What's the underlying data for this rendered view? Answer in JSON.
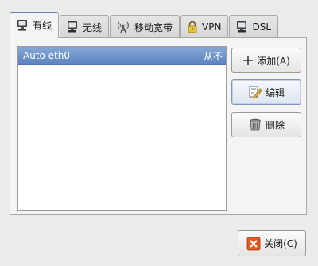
{
  "tabs": [
    {
      "label": "有线",
      "icon": "wired-network-icon",
      "active": true
    },
    {
      "label": "无线",
      "icon": "wireless-network-icon",
      "active": false
    },
    {
      "label": "移动宽带",
      "icon": "mobile-broadband-icon",
      "active": false
    },
    {
      "label": "VPN",
      "icon": "vpn-lock-icon",
      "active": false
    },
    {
      "label": "DSL",
      "icon": "dsl-network-icon",
      "active": false
    }
  ],
  "connections": [
    {
      "name": "Auto eth0",
      "last_used": "从不",
      "selected": true
    }
  ],
  "buttons": {
    "add_label": "添加(A)",
    "edit_label": "编辑",
    "delete_label": "删除",
    "close_label": "关闭(C)"
  },
  "colors": {
    "selection": "#5b83c0",
    "tab_accent": "#5a86c3",
    "close_icon": "#e25a1c"
  }
}
